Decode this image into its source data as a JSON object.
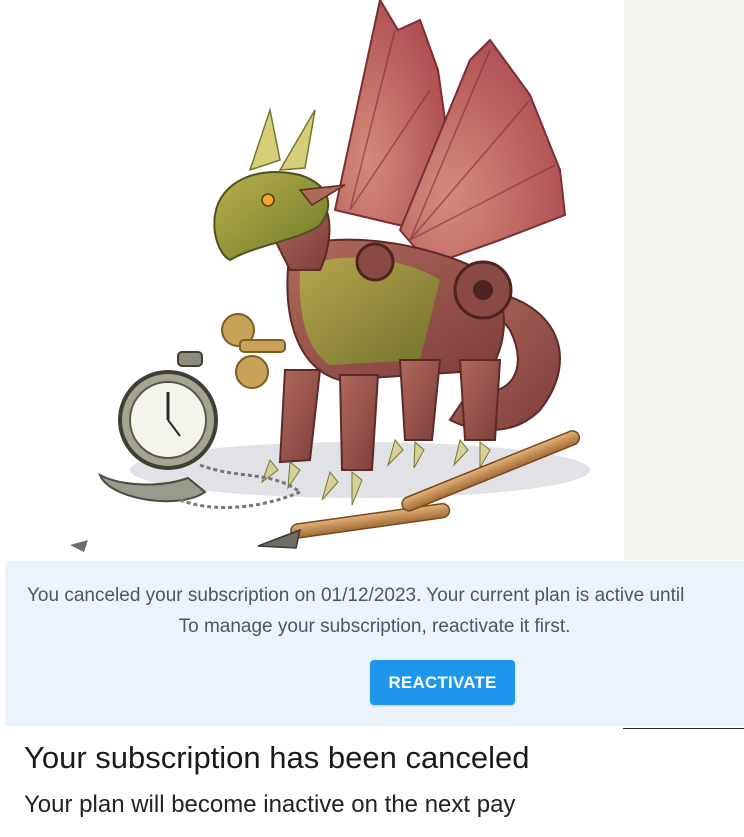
{
  "hero": {
    "illustration": "clockwork-dragon-with-pocket-watch"
  },
  "notice": {
    "line1": "You canceled your subscription on 01/12/2023. Your current plan is active until",
    "line2": "To manage your subscription, reactivate it first.",
    "reactivate_label": "REACTIVATE"
  },
  "status": {
    "title": "Your subscription has been canceled",
    "subtitle": "Your plan will become inactive on the next pay"
  },
  "colors": {
    "banner_bg": "#ebf3fc",
    "button_bg": "#1e96ec",
    "text_dark": "#1a1a1a"
  }
}
